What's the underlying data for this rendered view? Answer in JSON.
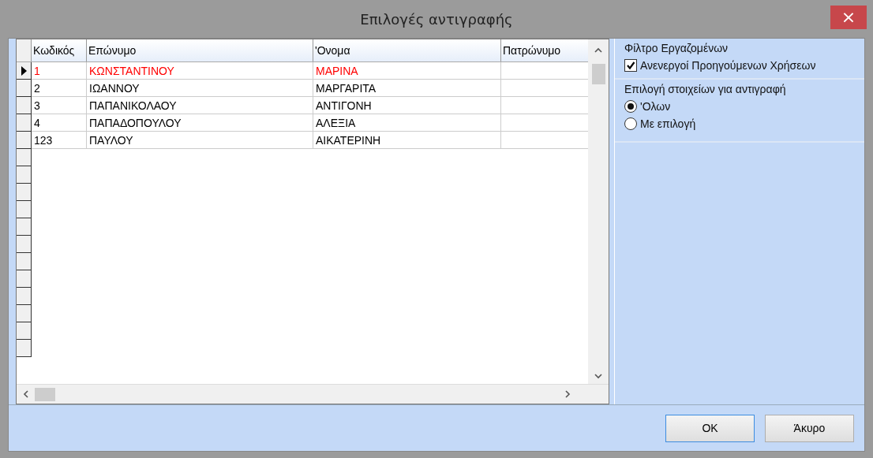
{
  "window": {
    "title": "Επιλογές αντιγραφής",
    "close": "×"
  },
  "table": {
    "columns": [
      "Κωδικός",
      "Επώνυμο",
      "'Ονομα",
      "Πατρώνυμο"
    ],
    "rows": [
      {
        "cells": [
          "1",
          "ΚΩΝΣΤΑΝΤΙΝΟΥ",
          "ΜΑΡΙΝΑ",
          ""
        ],
        "selected": true
      },
      {
        "cells": [
          "2",
          "ΙΩΑΝΝΟΥ",
          "ΜΑΡΓΑΡΙΤΑ",
          ""
        ],
        "selected": false
      },
      {
        "cells": [
          "3",
          "ΠΑΠΑΝΙΚΟΛΑΟΥ",
          "ΑΝΤΙΓΟΝΗ",
          ""
        ],
        "selected": false
      },
      {
        "cells": [
          "4",
          "ΠΑΠΑΔΟΠΟΥΛΟΥ",
          "ΑΛΕΞΙΑ",
          ""
        ],
        "selected": false
      },
      {
        "cells": [
          "123",
          "ΠΑΥΛΟΥ",
          "ΑΙΚΑΤΕΡΙΝΗ",
          ""
        ],
        "selected": false
      }
    ]
  },
  "filter": {
    "title": "Φίλτρο Εργαζομένων",
    "checkbox": {
      "label": "Ανενεργοί Προηγούμενων Χρήσεων",
      "checked": true
    }
  },
  "copy_options": {
    "title": "Επιλογή στοιχείων για αντιγραφή",
    "options": [
      {
        "label": "'Ολων",
        "selected": true
      },
      {
        "label": "Με επιλογή",
        "selected": false
      }
    ]
  },
  "buttons": [
    {
      "label": "OK",
      "default": true
    },
    {
      "label": "Άκυρο",
      "default": false
    }
  ]
}
